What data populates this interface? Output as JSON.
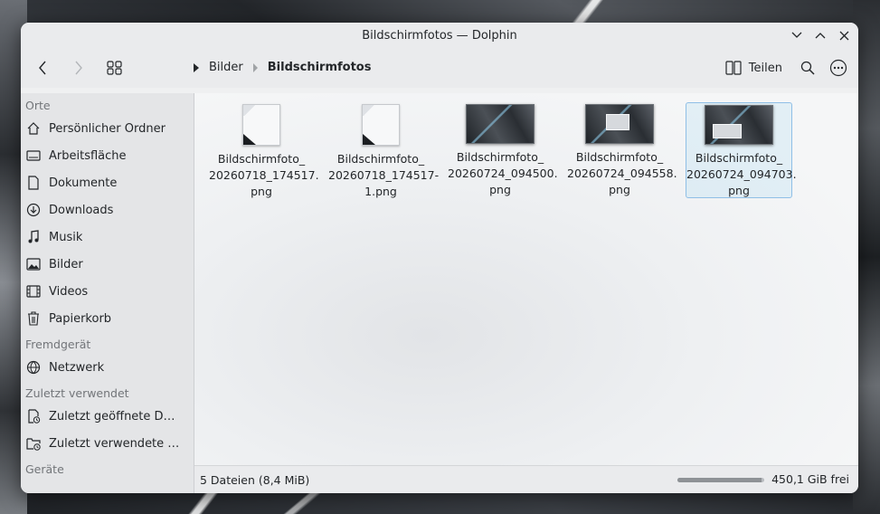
{
  "window": {
    "title": "Bildschirmfotos — Dolphin"
  },
  "toolbar": {
    "breadcrumb": [
      "Bilder",
      "Bildschirmfotos"
    ],
    "share_label": "Teilen"
  },
  "sidebar": {
    "sections": [
      {
        "title": "Orte",
        "items": [
          {
            "label": "Persönlicher Ordner",
            "icon": "home-icon"
          },
          {
            "label": "Arbeitsfläche",
            "icon": "desktop-icon"
          },
          {
            "label": "Dokumente",
            "icon": "document-icon"
          },
          {
            "label": "Downloads",
            "icon": "download-icon"
          },
          {
            "label": "Musik",
            "icon": "music-icon"
          },
          {
            "label": "Bilder",
            "icon": "picture-icon"
          },
          {
            "label": "Videos",
            "icon": "video-icon"
          },
          {
            "label": "Papierkorb",
            "icon": "trash-icon"
          }
        ]
      },
      {
        "title": "Fremdgerät",
        "items": [
          {
            "label": "Netzwerk",
            "icon": "network-icon"
          }
        ]
      },
      {
        "title": "Zuletzt verwendet",
        "items": [
          {
            "label": "Zuletzt geöffnete Dat…",
            "icon": "recent-files-icon"
          },
          {
            "label": "Zuletzt verwendete O…",
            "icon": "recent-folders-icon"
          }
        ]
      },
      {
        "title": "Geräte",
        "items": []
      }
    ]
  },
  "files": [
    {
      "name": "Bildschirmfoto_\n20260718_174517.\npng",
      "thumb": "document"
    },
    {
      "name": "Bildschirmfoto_\n20260718_174517-\n1.png",
      "thumb": "document"
    },
    {
      "name": "Bildschirmfoto_\n20260724_094500.\npng",
      "thumb": "image"
    },
    {
      "name": "Bildschirmfoto_\n20260724_094558.\npng",
      "thumb": "image"
    },
    {
      "name": "Bildschirmfoto_\n20260724_094703.\npng",
      "thumb": "image",
      "selected": true
    }
  ],
  "status": {
    "summary": "5 Dateien (8,4 MiB)",
    "free_space": "450,1 GiB frei",
    "disk_used_fraction": 0.97
  },
  "colors": {
    "accent": "#3daee9",
    "window_bg": "#eff0f1"
  }
}
